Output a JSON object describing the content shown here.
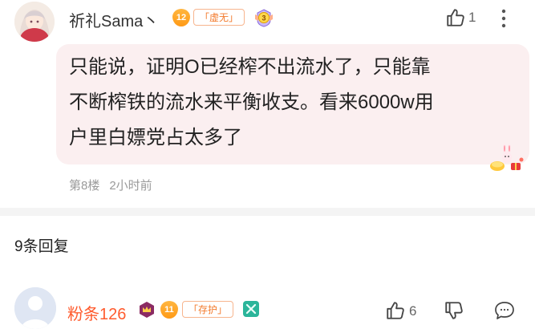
{
  "post": {
    "username": "祈礼Sama丶",
    "level": "12",
    "title_tag": "「虚无」",
    "badge_number": "3",
    "like_count": "1",
    "text_lines": [
      "只能说，证明O已经榨不出流水了，只能靠",
      "不断榨铁的流水来平衡收支。看来6000w用",
      "户里白嫖党占太多了"
    ],
    "floor": "第8楼",
    "time": "2小时前"
  },
  "replies": {
    "count_label": "9条回复"
  },
  "comment": {
    "username": "粉条126",
    "level": "11",
    "title_tag": "「存护」",
    "like_count": "6"
  },
  "colors": {
    "bubble": "#fbeff0",
    "tag_text": "#f37a2c",
    "level_badge": "#ff9a16",
    "vip_name": "#ff5b2e",
    "meta_gray": "#9a9a9a"
  },
  "icons": [
    "avatar",
    "level-badge-icon",
    "medal-icon",
    "thumbs-up-icon",
    "more-vertical-icon",
    "crown-icon",
    "sticker-icon",
    "thumbs-down-icon",
    "chat-icon",
    "ornament-icon"
  ]
}
